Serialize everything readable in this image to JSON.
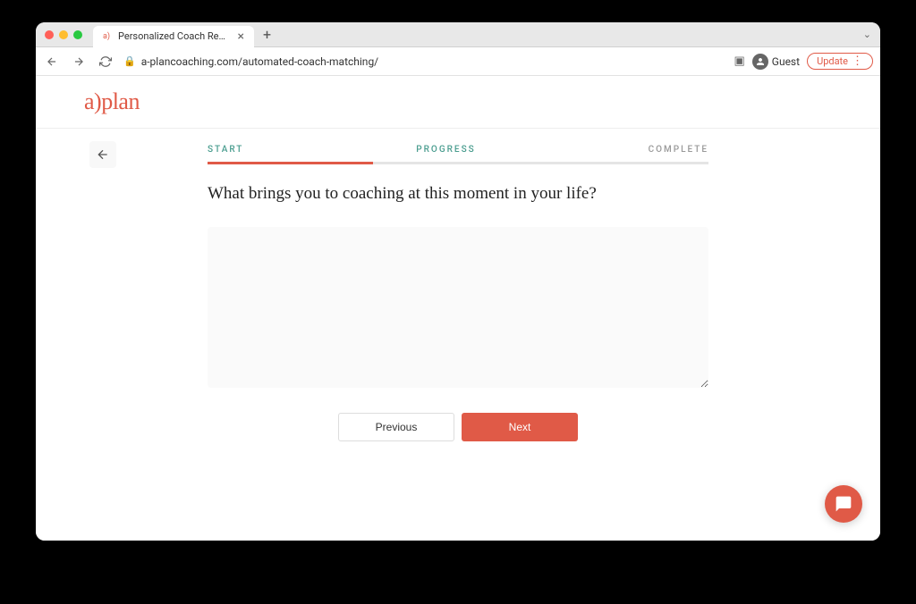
{
  "browser": {
    "tab_title": "Personalized Coach Recomme",
    "url": "a-plancoaching.com/automated-coach-matching/",
    "guest_label": "Guest",
    "update_label": "Update"
  },
  "page": {
    "logo": "a)plan",
    "steps": {
      "start": "START",
      "progress": "PROGRESS",
      "complete": "COMPLETE"
    },
    "question": "What brings you to coaching at this moment in your life?",
    "answer_value": "",
    "buttons": {
      "previous": "Previous",
      "next": "Next"
    }
  }
}
